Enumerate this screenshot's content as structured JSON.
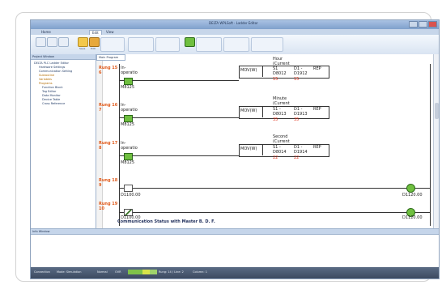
{
  "window": {
    "title": "DELTA WPLSoft · Ladder Editor"
  },
  "tabs": [
    "Home",
    "",
    "Edit",
    "View"
  ],
  "ribbon": {
    "buttons": [
      {
        "label": "",
        "color": "#e8eef7"
      },
      {
        "label": "",
        "color": "#e8eef7"
      },
      {
        "label": "",
        "color": "#e8eef7"
      },
      {
        "label": "",
        "color": "#f3c84b"
      },
      {
        "label": "",
        "color": "#e7a83b"
      },
      {
        "label": "",
        "color": "#7fb4e6"
      },
      {
        "label": "",
        "color": "#6fbf3f"
      },
      {
        "label": "",
        "color": "#7fb4e6"
      },
      {
        "label": "",
        "color": "#c9d7ea"
      },
      {
        "label": "",
        "color": "#c9d7ea"
      }
    ],
    "save_label": "Save",
    "edit_label": "Edit"
  },
  "project_pane": {
    "title": "Project Window",
    "tree": [
      "DELTA PLC Ladder Editor",
      "Hardware Settings",
      "Communication Setting",
      "Subroutine",
      "Variables",
      "Programs",
      "Function Block",
      "Tag Editor",
      "Data Monitor",
      "Device Table",
      "Cross Reference"
    ]
  },
  "editor": {
    "tab_label": "Main Program",
    "rungs": [
      {
        "rung": "Rung 15",
        "rung_num": "6",
        "comment": "In-",
        "comment2": "operatio",
        "contact": "M8125",
        "box_comment": "Hour",
        "box_comment2": "(Current",
        "op": "MOV(W)",
        "s1": "S1",
        "s1v": "D8012",
        "d1": "D1 -",
        "d1v": "D1912",
        "rep": "REP",
        "val1": "15",
        "val2": "15"
      },
      {
        "rung": "Rung 16",
        "rung_num": "7",
        "comment": "In-",
        "comment2": "operatio",
        "contact": "M8125",
        "box_comment": "Minute",
        "box_comment2": "(Current",
        "op": "MOV(W)",
        "s1": "S1 -",
        "s1v": "D8013",
        "d1": "D1 -",
        "d1v": "D1913",
        "rep": "REP",
        "val1": "35",
        "val2": "35"
      },
      {
        "rung": "Rung 17",
        "rung_num": "8",
        "comment": "In-",
        "comment2": "operatio",
        "contact": "M8125",
        "box_comment": "Second",
        "box_comment2": "(Current",
        "op": "MOV(W)",
        "s1": "S1 -",
        "s1v": "D8014",
        "d1": "D1 -",
        "d1v": "D1914",
        "rep": "REP",
        "val1": "22",
        "val2": "22"
      }
    ],
    "rung18": {
      "rung": "Rung 18",
      "rung_num": "9",
      "contact": "D1100.00",
      "coil": "D1120.00"
    },
    "rung19": {
      "rung": "Rung 19",
      "rung_num": "10",
      "contact": "D1100.00",
      "coil": "D1120.00"
    },
    "status_message": "Communication Status with Master B. D. F."
  },
  "info_pane": {
    "title": "Info Window"
  },
  "statusbar": {
    "items": [
      "Connection",
      "Mode: Simulation",
      "Normal",
      "OVR"
    ],
    "cells": [
      "Rung: 14 / Line: 2",
      "Column: 1"
    ],
    "cell_colors": [
      "#7fc24a",
      "#7fc24a",
      "#d7e34a",
      "#9fd36b"
    ]
  }
}
